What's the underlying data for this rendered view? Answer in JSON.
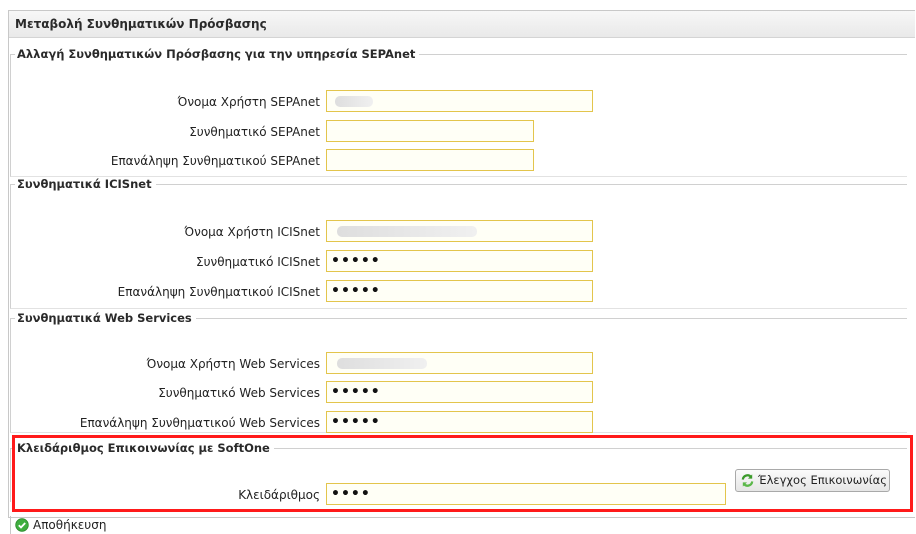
{
  "panel": {
    "title": "Μεταβολή Συνθηματικών Πρόσβασης"
  },
  "sepanet": {
    "legend": "Αλλαγή Συνθηματικών Πρόσβασης για την υπηρεσία SEPAnet",
    "username_label": "Όνομα Χρήστη SEPAnet",
    "password_label": "Συνθηματικό SEPAnet",
    "repeat_label": "Επανάληψη Συνθηματικού SEPAnet",
    "password_value": "",
    "repeat_value": ""
  },
  "icisnet": {
    "legend": "Συνθηματικά ICISnet",
    "username_label": "Όνομα Χρήστη ICISnet",
    "password_label": "Συνθηματικό ICISnet",
    "repeat_label": "Επανάληψη Συνθηματικού ICISnet",
    "password_value": "•••••",
    "repeat_value": "•••••"
  },
  "webservices": {
    "legend": "Συνθηματικά Web Services",
    "username_label": "Όνομα Χρήστη Web Services",
    "password_label": "Συνθηματικό Web Services",
    "repeat_label": "Επανάληψη Συνθηματικού Web Services",
    "password_value": "•••••",
    "repeat_value": "•••••"
  },
  "softone": {
    "legend": "Κλειδάριθμος Επικοινωνίας με SoftOne",
    "key_label": "Κλειδάριθμος",
    "key_value": "••••",
    "check_button": "Έλεγχος Επικοινωνίας"
  },
  "footer": {
    "save_label": "Αποθήκευση"
  },
  "colors": {
    "highlight": "#ff1a1a",
    "input_border": "#e3c54c",
    "save_icon": "#3fae3f"
  }
}
